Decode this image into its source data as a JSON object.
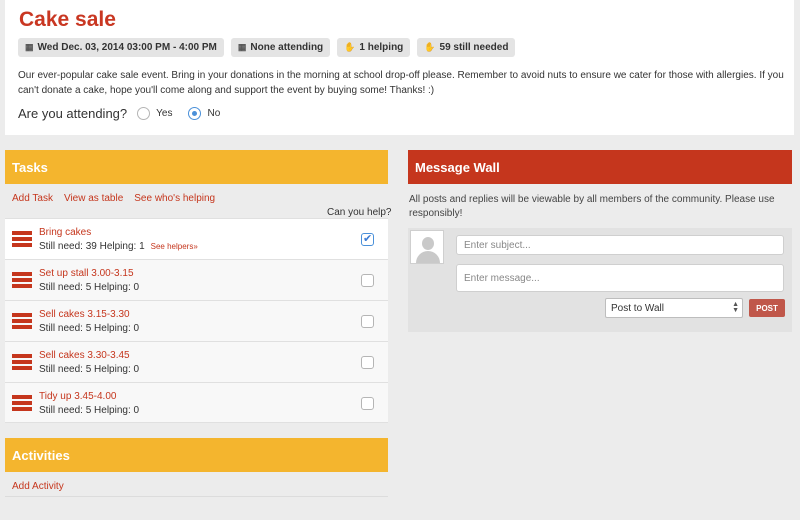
{
  "event": {
    "title": "Cake sale",
    "badges": [
      {
        "icon": "calendar-icon",
        "text": "Wed Dec. 03, 2014 03:00 PM - 4:00 PM"
      },
      {
        "icon": "attending-icon",
        "text": "None attending"
      },
      {
        "icon": "helping-icon",
        "text": "1 helping"
      },
      {
        "icon": "needed-icon",
        "text": "59 still needed"
      }
    ],
    "description": "Our ever-popular cake sale event. Bring in your donations in the morning at school drop-off please. Remember to avoid nuts to ensure we cater for those with allergies. If you can't donate a cake, hope you'll come along and support the event by buying some! Thanks! :)",
    "attending_question": "Are you attending?",
    "attending_options": [
      "Yes",
      "No"
    ],
    "attending_selected": "No"
  },
  "tasks": {
    "heading": "Tasks",
    "links": [
      "Add Task",
      "View as table",
      "See who's helping"
    ],
    "can_help_label": "Can you help?",
    "items": [
      {
        "name": "Bring cakes",
        "status": "Still need: 39 Helping: 1",
        "see_helpers": "See helpers»",
        "checked": true
      },
      {
        "name": "Set up stall 3.00-3.15",
        "status": "Still need: 5 Helping: 0",
        "checked": false
      },
      {
        "name": "Sell cakes 3.15-3.30",
        "status": "Still need: 5 Helping: 0",
        "checked": false
      },
      {
        "name": "Sell cakes 3.30-3.45",
        "status": "Still need: 5 Helping: 0",
        "checked": false
      },
      {
        "name": "Tidy up 3.45-4.00",
        "status": "Still need: 5 Helping: 0",
        "checked": false
      }
    ]
  },
  "activities": {
    "heading": "Activities",
    "add_label": "Add Activity"
  },
  "wall": {
    "heading": "Message Wall",
    "note": "All posts and replies will be viewable by all members of the community. Please use responsibly!",
    "subject_placeholder": "Enter subject...",
    "message_placeholder": "Enter message...",
    "post_target": "Post to Wall",
    "post_button": "POST"
  },
  "colors": {
    "accent_orange": "#f4b52e",
    "accent_red": "#c5361d",
    "title_red": "#c93722"
  }
}
